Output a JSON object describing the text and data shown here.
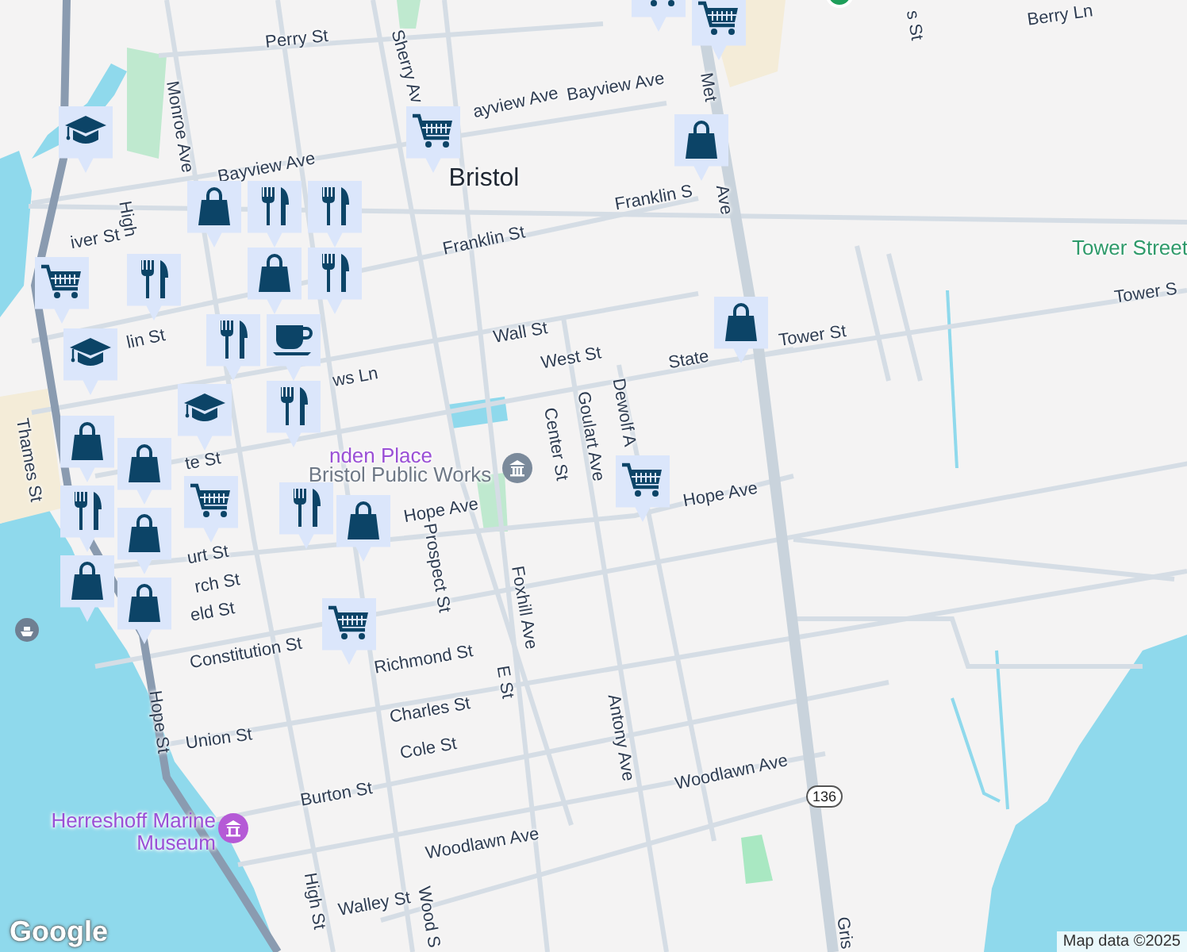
{
  "map": {
    "labels": [
      {
        "text": "Perry St",
        "kind": "street"
      },
      {
        "text": "Sherry Av",
        "kind": "street"
      },
      {
        "text": "Monroe Ave",
        "kind": "street"
      },
      {
        "text": "ayview Ave",
        "kind": "street"
      },
      {
        "text": "Bayview Ave",
        "kind": "street"
      },
      {
        "text": "Bayview Ave",
        "kind": "street"
      },
      {
        "text": "Bristol",
        "kind": "city"
      },
      {
        "text": "High",
        "kind": "street"
      },
      {
        "text": "iver St",
        "kind": "street"
      },
      {
        "text": "Franklin St",
        "kind": "street"
      },
      {
        "text": "Franklin S",
        "kind": "street"
      },
      {
        "text": "Met",
        "kind": "street"
      },
      {
        "text": "Ave",
        "kind": "street"
      },
      {
        "text": "lin St",
        "kind": "street"
      },
      {
        "text": "Wall St",
        "kind": "street"
      },
      {
        "text": "West St",
        "kind": "street"
      },
      {
        "text": "ws Ln",
        "kind": "street"
      },
      {
        "text": "State",
        "kind": "street"
      },
      {
        "text": "Tower St",
        "kind": "street"
      },
      {
        "text": "Tower S",
        "kind": "street"
      },
      {
        "text": "Tower Street",
        "kind": "park"
      },
      {
        "text": "Center St",
        "kind": "street"
      },
      {
        "text": "Goulart Ave",
        "kind": "street"
      },
      {
        "text": "Dewolf A",
        "kind": "street"
      },
      {
        "text": "Berry Ln",
        "kind": "street"
      },
      {
        "text": "s St",
        "kind": "street"
      },
      {
        "text": "nden Place",
        "kind": "attraction"
      },
      {
        "text": "Bristol Public Works",
        "kind": "poi"
      },
      {
        "text": "Hope Ave",
        "kind": "street"
      },
      {
        "text": "Hope Ave",
        "kind": "street"
      },
      {
        "text": "Thames St",
        "kind": "street"
      },
      {
        "text": "te St",
        "kind": "street"
      },
      {
        "text": "urt St",
        "kind": "street"
      },
      {
        "text": "rch St",
        "kind": "street"
      },
      {
        "text": "eld St",
        "kind": "street"
      },
      {
        "text": "Constitution St",
        "kind": "street"
      },
      {
        "text": "Prospect St",
        "kind": "street"
      },
      {
        "text": "Foxhill Ave",
        "kind": "street"
      },
      {
        "text": "Richmond St",
        "kind": "street"
      },
      {
        "text": "E St",
        "kind": "street"
      },
      {
        "text": "Charles St",
        "kind": "street"
      },
      {
        "text": "Union St",
        "kind": "street"
      },
      {
        "text": "Cole St",
        "kind": "street"
      },
      {
        "text": "Burton St",
        "kind": "street"
      },
      {
        "text": "Hope St",
        "kind": "street"
      },
      {
        "text": "Herreshoff Marine Museum",
        "kind": "attraction"
      },
      {
        "text": "High St",
        "kind": "street"
      },
      {
        "text": "Walley St",
        "kind": "street"
      },
      {
        "text": "Wood S",
        "kind": "street"
      },
      {
        "text": "Woodlawn Ave",
        "kind": "street"
      },
      {
        "text": "Woodlawn Ave",
        "kind": "street"
      },
      {
        "text": "Antony Ave",
        "kind": "street"
      },
      {
        "text": "Gris",
        "kind": "street"
      }
    ],
    "route_shield": "136",
    "pins": [
      {
        "kind": "cart"
      },
      {
        "kind": "cart"
      },
      {
        "kind": "school"
      },
      {
        "kind": "cart"
      },
      {
        "kind": "bag"
      },
      {
        "kind": "bag"
      },
      {
        "kind": "food"
      },
      {
        "kind": "food"
      },
      {
        "kind": "food"
      },
      {
        "kind": "bag"
      },
      {
        "kind": "food"
      },
      {
        "kind": "cart"
      },
      {
        "kind": "food"
      },
      {
        "kind": "coffee"
      },
      {
        "kind": "food"
      },
      {
        "kind": "school"
      },
      {
        "kind": "school"
      },
      {
        "kind": "bag"
      },
      {
        "kind": "cart"
      },
      {
        "kind": "bag"
      },
      {
        "kind": "bag"
      },
      {
        "kind": "food"
      },
      {
        "kind": "bag"
      },
      {
        "kind": "bag"
      },
      {
        "kind": "bag"
      },
      {
        "kind": "cart"
      },
      {
        "kind": "food"
      },
      {
        "kind": "bag"
      },
      {
        "kind": "cart"
      }
    ],
    "attribution": "Map data ©2025",
    "logo": "Google"
  }
}
